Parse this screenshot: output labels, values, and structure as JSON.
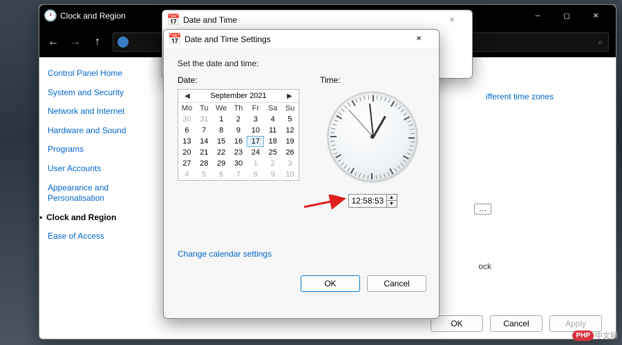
{
  "control_panel": {
    "title": "Clock and Region",
    "side_home": "Control Panel Home",
    "side_items": [
      "System and Security",
      "Network and Internet",
      "Hardware and Sound",
      "Programs",
      "User Accounts",
      "Appearance and\nPersonalisation",
      "Clock and Region",
      "Ease of Access"
    ],
    "selected_index": 6,
    "main_link": "ifferent time zones",
    "peek_dots": "…",
    "peek_txt": "ock",
    "buttons": {
      "ok": "OK",
      "cancel": "Cancel",
      "apply": "Apply"
    }
  },
  "date_time_dialog": {
    "title": "Date and Time"
  },
  "settings_dialog": {
    "title": "Date and Time Settings",
    "instruction": "Set the date and time:",
    "date_label": "Date:",
    "time_label": "Time:",
    "calendar": {
      "month": "September 2021",
      "dow": [
        "Mo",
        "Tu",
        "We",
        "Th",
        "Fr",
        "Sa",
        "Su"
      ],
      "leading_other": [
        30,
        31
      ],
      "days": [
        1,
        2,
        3,
        4,
        5,
        6,
        7,
        8,
        9,
        10,
        11,
        12,
        13,
        14,
        15,
        16,
        17,
        18,
        19,
        20,
        21,
        22,
        23,
        24,
        25,
        26,
        27,
        28,
        29,
        30
      ],
      "trailing_other": [
        1,
        2,
        3,
        4,
        5,
        6,
        7,
        8,
        9,
        10
      ],
      "selected_day": 17
    },
    "time_value": "12:58:53",
    "link": "Change calendar settings",
    "buttons": {
      "ok": "OK",
      "cancel": "Cancel"
    }
  },
  "watermark": {
    "badge": "PHP",
    "text": "中文网"
  }
}
